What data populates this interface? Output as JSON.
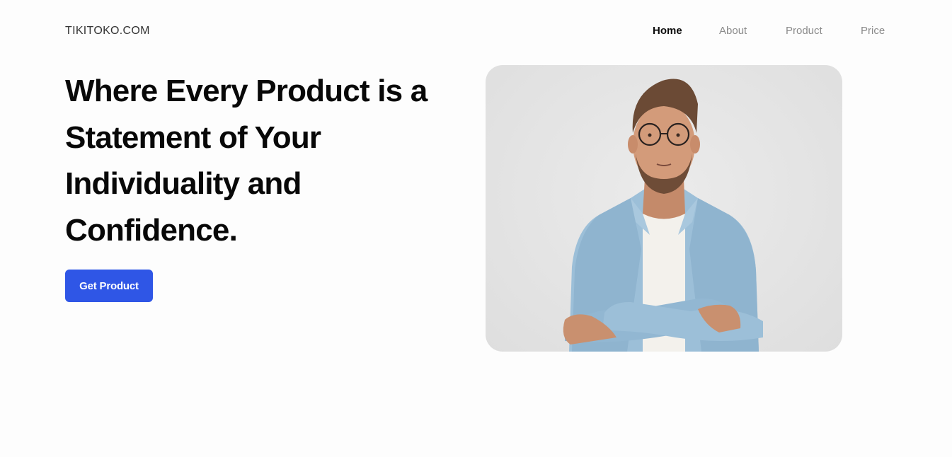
{
  "brand": {
    "logo_text": "TIKITOKO.COM"
  },
  "nav": {
    "items": [
      {
        "label": "Home",
        "active": true
      },
      {
        "label": "About",
        "active": false
      },
      {
        "label": "Product",
        "active": false
      },
      {
        "label": "Price",
        "active": false
      }
    ]
  },
  "hero": {
    "headline": "Where Every Product is a Statement of Your Individuality and Confidence.",
    "cta_label": "Get Product"
  },
  "colors": {
    "accent": "#2f56e6",
    "nav_inactive": "#8b8b8b",
    "text": "#080808"
  }
}
